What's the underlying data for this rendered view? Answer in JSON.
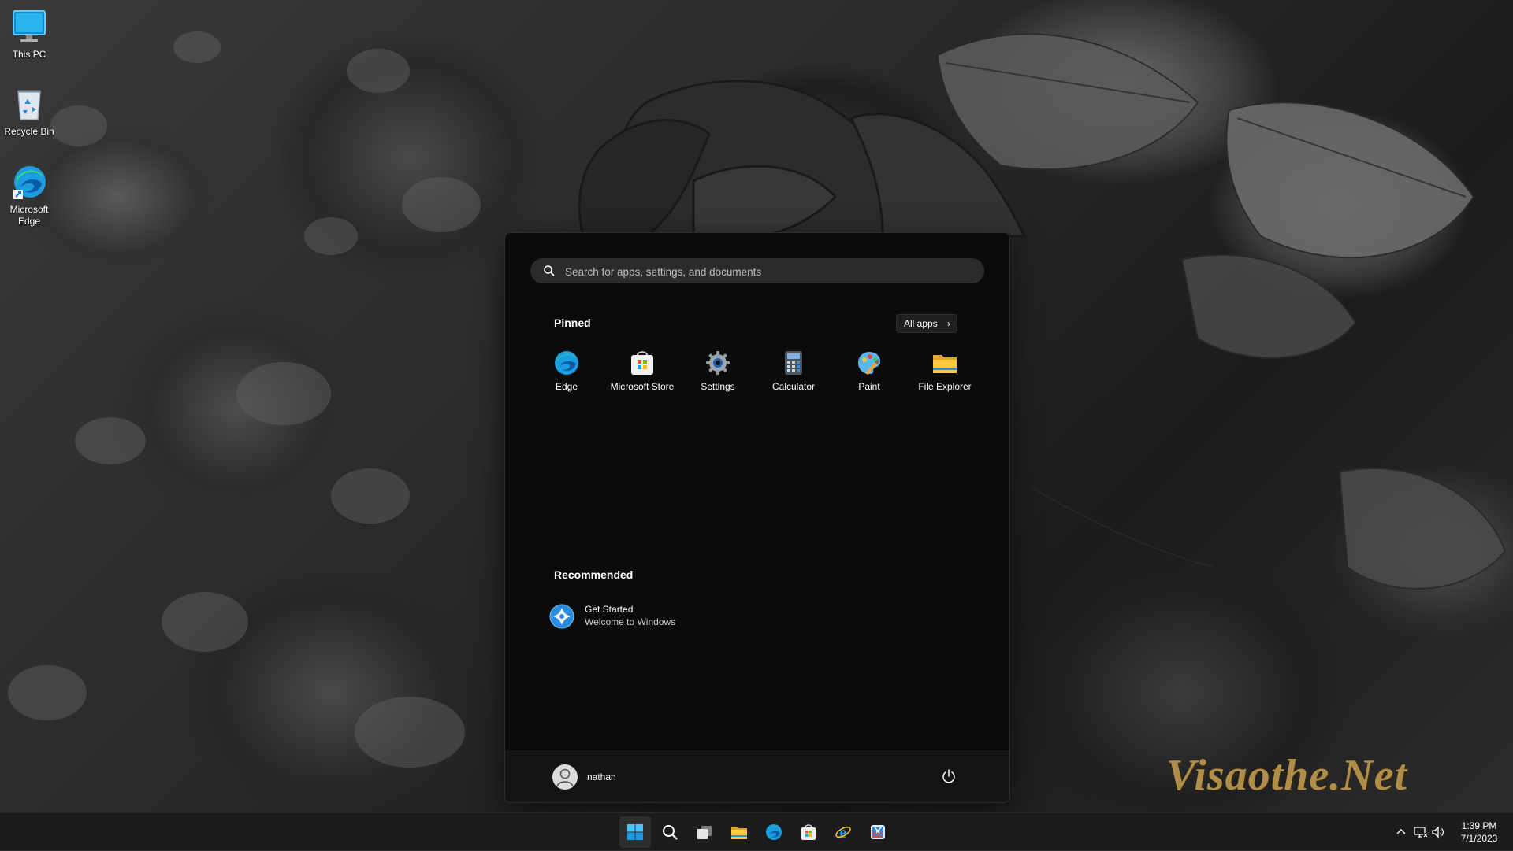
{
  "desktop": {
    "icons": [
      {
        "label": "This PC",
        "icon": "monitor-icon"
      },
      {
        "label": "Recycle Bin",
        "icon": "recycle-bin-icon"
      },
      {
        "label": "Microsoft Edge",
        "icon": "edge-icon"
      }
    ],
    "watermark": "Visaothe.Net"
  },
  "start_menu": {
    "search_placeholder": "Search for apps, settings, and documents",
    "pinned_title": "Pinned",
    "all_apps_label": "All apps",
    "pinned": [
      {
        "label": "Edge",
        "icon": "edge-icon"
      },
      {
        "label": "Microsoft Store",
        "icon": "store-icon"
      },
      {
        "label": "Settings",
        "icon": "gear-icon"
      },
      {
        "label": "Calculator",
        "icon": "calculator-icon"
      },
      {
        "label": "Paint",
        "icon": "paint-icon"
      },
      {
        "label": "File Explorer",
        "icon": "folder-icon"
      }
    ],
    "recommended_title": "Recommended",
    "recommended": [
      {
        "title": "Get Started",
        "subtitle": "Welcome to Windows",
        "icon": "get-started-icon"
      }
    ],
    "user_name": "nathan"
  },
  "taskbar": {
    "items": [
      "start-icon",
      "search-icon",
      "task-view-icon",
      "folder-icon",
      "edge-icon",
      "store-icon",
      "internet-explorer-icon",
      "snipping-tool-icon"
    ],
    "tray": [
      "chevron-up-icon",
      "network-icon",
      "volume-icon"
    ],
    "time": "1:39 PM",
    "date": "7/1/2023"
  },
  "colors": {
    "accent": "#0078d4",
    "start_bg": "#0b0b0b",
    "taskbar_bg": "#1c1c1c"
  }
}
